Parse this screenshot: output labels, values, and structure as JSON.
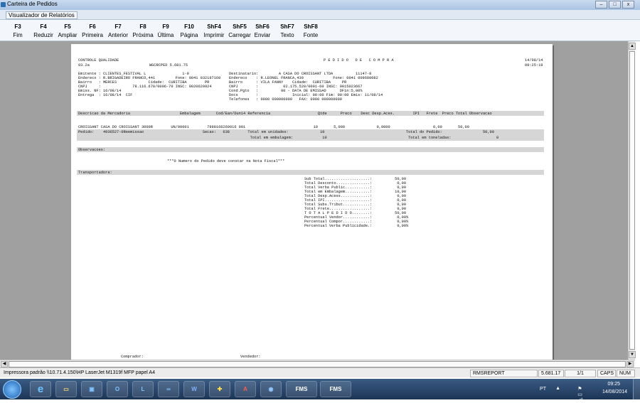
{
  "window": {
    "title": "Carteira de Pedidos",
    "menu_label": "Visualizador de Relatórios",
    "buttons": [
      "–",
      "□",
      "x"
    ]
  },
  "toolbar": [
    {
      "key": "F3",
      "label": "Fim"
    },
    {
      "key": "F4",
      "label": "Reduzir"
    },
    {
      "key": "F5",
      "label": "Ampliar"
    },
    {
      "key": "F6",
      "label": "Primeira"
    },
    {
      "key": "F7",
      "label": "Anterior"
    },
    {
      "key": "F8",
      "label": "Próxima"
    },
    {
      "key": "F9",
      "label": "Última"
    },
    {
      "key": "F10",
      "label": "Página"
    },
    {
      "key": "ShF4",
      "label": "Imprimir"
    },
    {
      "key": "ShF5",
      "label": "Carregar"
    },
    {
      "key": "ShF6",
      "label": "Enviar"
    },
    {
      "key": "ShF7",
      "label": "Texto"
    },
    {
      "key": "ShF8",
      "label": "Fonte"
    }
  ],
  "report": {
    "header_left1": "CONTROLE QUALIDADE",
    "header_left2": "03.2a",
    "header_code": "WGCRCPED 5.681.75",
    "title": "P E D I D O   D E   C O M P R A",
    "date": "14/08/14",
    "time": "09:25:19",
    "emitente_block": "Emitente : CLIENTES_FESTIVAL L                1-9\nEndereco : R.BRIGADEIRO FRANCO,441         Fone: 0041 032197160\nBairro   : MERCES              Cidade:  CURITIBA        PR\nCNPJ     :              78.116.670/0006-70 INSC: 9020620924\nEmiss. NF: 16/08/14\nEntrega  : 16/08/14  CIF",
    "destinatario_block": "Destinatario:         A CASA DO CROISSANT LTDA          11147-8\nEndereco    : R.LEONEL FRANCA,439             Fone: 0041 009680082\nBairro      : VILA FANNY    Cidade:  CURITIBA     PR\nCNPJ        :           02.175.520/0001-60 INSC: 9015023667\nCond.Pgto   :          00 - DATA DE EMISSAO      DFin:5,00%\nDocs        :               Inicial: 00:00 Fim: 00:00 Emis: 11/08/14\nTelefones   : 0000 000000000   FAX: 0000 000000000",
    "cols_header": "Descricao da Mercadoria                      Embalagem       Cod/Ean/Dun14 Referencia                     Qtde      Preco    Desc Desp.Aces.        IPI   Frete  Preco Total Observacao",
    "item_line": "CROISSANT CASA DO CROISSANT 3000R        UN/00001        7898166260016 001                              10       5,000              0,0000                   0,00       50,00",
    "totals_line1": "Pedido:    4936527-0Reemissao                          Secao:   638        Total em unidades:              10                                    Total do Pedido:                  50,00",
    "totals_line2": "                                                                            Total em embalagem:             10                                    Total em toneladas:                    0",
    "observacoes": "Observacoes:",
    "nota_fiscal": "***O Numero do Pedido deve constar na Nota Fiscal***",
    "transportadora": "Transportadora:",
    "summary": "Sub Total....................:          50,00\nTotal Desconto...............:           0,00\nTotal Verba Public...........:           0,00\nTotal em Embalagem...........:          10,00\nTotal Desp.Acess.............:           0,00\nTotal IPI....................:           0,00\nTotal Subs.Tribut............:           0,00\nTotal Frete..................:           0,00\nT O T A L P E D I D O........:          50,00\nPercentual Vendor............:           0,00%\nPercentual Compor............:           0,00%\nPercentual Verba Publicidade.:           0,00%",
    "comprador": "Comprador:",
    "vendedor": "Vendedor:"
  },
  "statusbar": {
    "printer": "Impressora padrão \\\\10.71.4.150\\HP LaserJet M1319f MFP papel A4",
    "report": "RMSREPORT",
    "version": "5.681.17",
    "page": "1/1",
    "caps": "CAPS",
    "num": "NUM"
  },
  "taskbar": {
    "fms1": "FMS",
    "fms2": "FMS",
    "lang": "PT",
    "clock_time": "09:25",
    "clock_date": "14/08/2014"
  }
}
